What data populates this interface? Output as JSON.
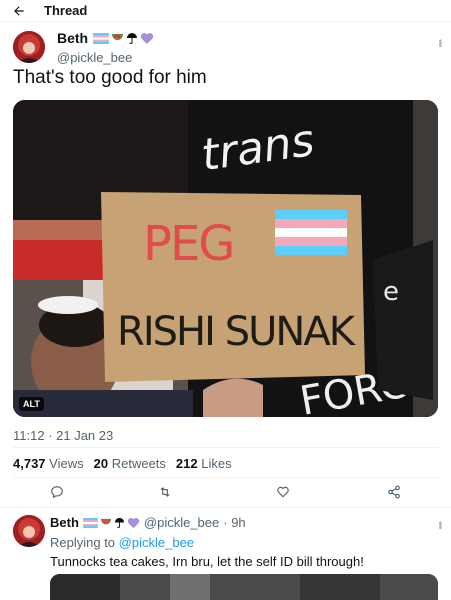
{
  "header": {
    "title": "Thread",
    "back_icon": "arrow-left-icon"
  },
  "tweet": {
    "author_name": "Beth",
    "author_emojis": [
      "trans-flag-icon",
      "watermelon-icon",
      "umbrella-icon",
      "purple-heart-icon"
    ],
    "handle": "@pickle_bee",
    "text": "That's too good for him",
    "image": {
      "alt_badge": "ALT",
      "sign_text_line1": "PEG",
      "sign_text_line2": "RISHI SUNAK",
      "banner_text_top": "trans",
      "banner_text_right": "FORCE"
    },
    "timestamp": "11:12 · 21 Jan 23",
    "stats": {
      "views_count": "4,737",
      "views_label": "Views",
      "retweets_count": "20",
      "retweets_label": "Retweets",
      "likes_count": "212",
      "likes_label": "Likes"
    },
    "actions": [
      "reply-icon",
      "retweet-icon",
      "like-icon",
      "share-icon"
    ]
  },
  "reply": {
    "author_name": "Beth",
    "handle": "@pickle_bee",
    "time": "· 9h",
    "replying_prefix": "Replying to",
    "replying_to": "@pickle_bee",
    "text": "Tunnocks tea cakes, Irn bru, let the self ID bill through!"
  },
  "colors": {
    "accent": "#1d9bf0",
    "secondary_text": "#536471",
    "divider": "#eff3f4",
    "trans_blue": "#5bcefa",
    "trans_pink": "#f5a9b8"
  }
}
